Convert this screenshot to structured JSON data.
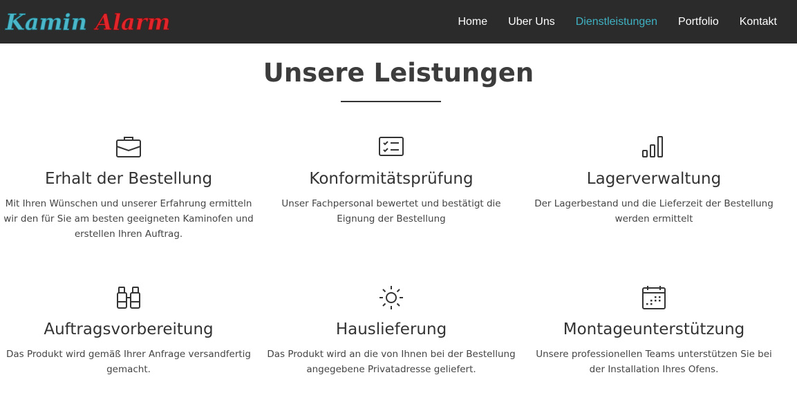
{
  "brand": {
    "logo_text": "KaminAlarm",
    "logo_part1": "Kamin",
    "logo_part2": "Alarm",
    "logo_color_1": "#4cb7c9",
    "logo_color_2": "#e0262b"
  },
  "nav": {
    "items": [
      {
        "label": "Home",
        "active": false
      },
      {
        "label": "Uber Uns",
        "active": false
      },
      {
        "label": "Dienstleistungen",
        "active": true
      },
      {
        "label": "Portfolio",
        "active": false
      },
      {
        "label": "Kontakt",
        "active": false
      }
    ],
    "accent_color": "#3fb1c2",
    "background": "#2b2b2b"
  },
  "section": {
    "title": "Unsere Leistungen"
  },
  "services": [
    {
      "icon": "briefcase-icon",
      "title": "Erhalt der Bestellung",
      "text": "Mit Ihren Wünschen und unserer Erfahrung ermitteln wir den für Sie am besten geeigneten Kaminofen und erstellen Ihren Auftrag."
    },
    {
      "icon": "checklist-icon",
      "title": "Konformitätsprüfung",
      "text": "Unser Fachpersonal bewertet und bestätigt die Eignung der Bestellung"
    },
    {
      "icon": "bar-chart-icon",
      "title": "Lagerverwaltung",
      "text": "Der Lagerbestand und die Lieferzeit der Bestellung werden ermittelt"
    },
    {
      "icon": "binoculars-icon",
      "title": "Auftragsvorbereitung",
      "text": "Das Produkt wird gemäß Ihrer Anfrage versandfertig gemacht."
    },
    {
      "icon": "sun-icon",
      "title": "Hauslieferung",
      "text": "Das Produkt wird an die von Ihnen bei der Bestellung angegebene Privatadresse geliefert."
    },
    {
      "icon": "calendar-icon",
      "title": "Montageunterstützung",
      "text": "Unsere professionellen Teams unterstützen Sie bei der Installation Ihres Ofens."
    }
  ]
}
